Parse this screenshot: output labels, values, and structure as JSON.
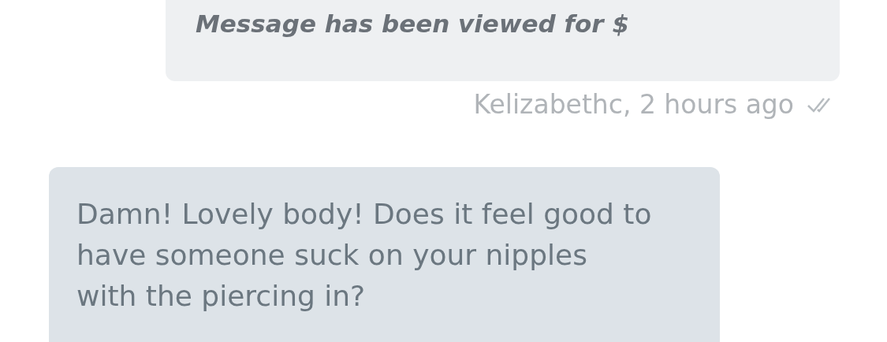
{
  "messages": [
    {
      "kind": "notice",
      "outgoing": true,
      "text": "Message has been viewed for $",
      "meta": "Kelizabethc, 2 hours ago",
      "read": true
    },
    {
      "kind": "text",
      "outgoing": false,
      "text": "Damn! Lovely body! Does it feel good to have someone suck on your nipples with the piercing in?"
    }
  ]
}
